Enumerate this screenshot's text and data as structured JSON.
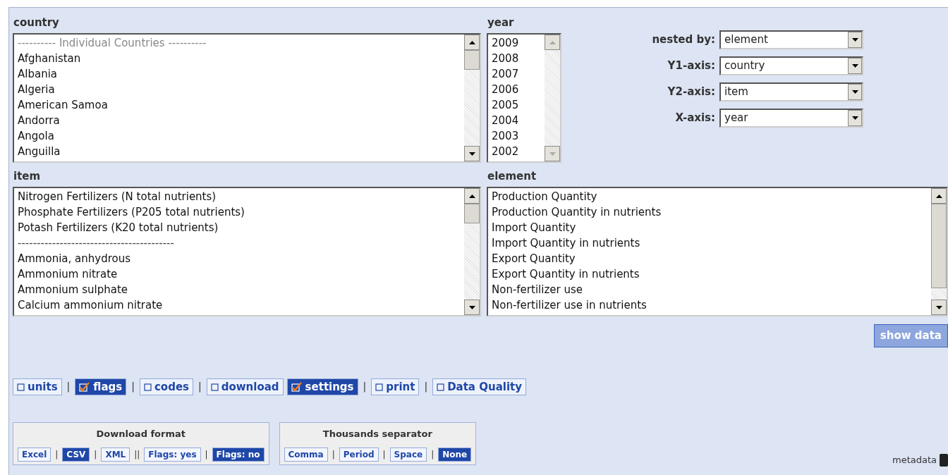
{
  "filters": {
    "country": {
      "label": "country",
      "items": [
        {
          "text": "---------- Individual Countries ----------",
          "kind": "header"
        },
        {
          "text": "Afghanistan",
          "kind": "option"
        },
        {
          "text": "Albania",
          "kind": "option"
        },
        {
          "text": "Algeria",
          "kind": "option"
        },
        {
          "text": "American Samoa",
          "kind": "option"
        },
        {
          "text": "Andorra",
          "kind": "option"
        },
        {
          "text": "Angola",
          "kind": "option"
        },
        {
          "text": "Anguilla",
          "kind": "option"
        }
      ]
    },
    "year": {
      "label": "year",
      "items": [
        {
          "text": "2009"
        },
        {
          "text": "2008"
        },
        {
          "text": "2007"
        },
        {
          "text": "2006"
        },
        {
          "text": "2005"
        },
        {
          "text": "2004"
        },
        {
          "text": "2003"
        },
        {
          "text": "2002"
        }
      ]
    },
    "item": {
      "label": "item",
      "items": [
        {
          "text": "Nitrogen Fertilizers (N total nutrients)",
          "kind": "option"
        },
        {
          "text": "Phosphate Fertilizers (P205 total nutrients)",
          "kind": "option"
        },
        {
          "text": "Potash Fertilizers (K20 total nutrients)",
          "kind": "option"
        },
        {
          "text": "-----------------------------------------",
          "kind": "separator"
        },
        {
          "text": "Ammonia, anhydrous",
          "kind": "option"
        },
        {
          "text": "Ammonium nitrate",
          "kind": "option"
        },
        {
          "text": "Ammonium sulphate",
          "kind": "option"
        },
        {
          "text": "Calcium ammonium nitrate",
          "kind": "option"
        }
      ]
    },
    "element": {
      "label": "element",
      "items": [
        {
          "text": "Production Quantity"
        },
        {
          "text": "Production Quantity in nutrients"
        },
        {
          "text": "Import Quantity"
        },
        {
          "text": "Import Quantity in nutrients"
        },
        {
          "text": "Export Quantity"
        },
        {
          "text": "Export Quantity in nutrients"
        },
        {
          "text": "Non-fertilizer use"
        },
        {
          "text": "Non-fertilizer use in nutrients"
        }
      ]
    }
  },
  "layout_settings": [
    {
      "label": "nested by:",
      "value": "element"
    },
    {
      "label": "Y1-axis:",
      "value": "country"
    },
    {
      "label": "Y2-axis:",
      "value": "item"
    },
    {
      "label": "X-axis:",
      "value": "year"
    }
  ],
  "show_data_button": "show data",
  "toggles": [
    {
      "label": "units",
      "checked": false,
      "separator_after": "|"
    },
    {
      "label": "flags",
      "checked": true,
      "separator_after": "|"
    },
    {
      "label": "codes",
      "checked": false,
      "separator_after": "|"
    },
    {
      "label": "download",
      "checked": false
    },
    {
      "label": "settings",
      "checked": true,
      "separator_after": "|"
    },
    {
      "label": "print",
      "checked": false,
      "separator_after": "|"
    },
    {
      "label": "Data Quality",
      "checked": false
    }
  ],
  "option_boxes": [
    {
      "title": "Download format",
      "options": [
        {
          "label": "Excel",
          "selected": false,
          "separator_after": "|"
        },
        {
          "label": "CSV",
          "selected": true,
          "separator_after": "|"
        },
        {
          "label": "XML",
          "selected": false,
          "separator_after": "||"
        },
        {
          "label": "Flags: yes",
          "selected": false,
          "separator_after": "|"
        },
        {
          "label": "Flags: no",
          "selected": true
        }
      ]
    },
    {
      "title": "Thousands separator",
      "options": [
        {
          "label": "Comma",
          "selected": false,
          "separator_after": "|"
        },
        {
          "label": "Period",
          "selected": false,
          "separator_after": "|"
        },
        {
          "label": "Space",
          "selected": false,
          "separator_after": "|"
        },
        {
          "label": "None",
          "selected": true
        }
      ]
    }
  ],
  "metadata_link": "metadata"
}
